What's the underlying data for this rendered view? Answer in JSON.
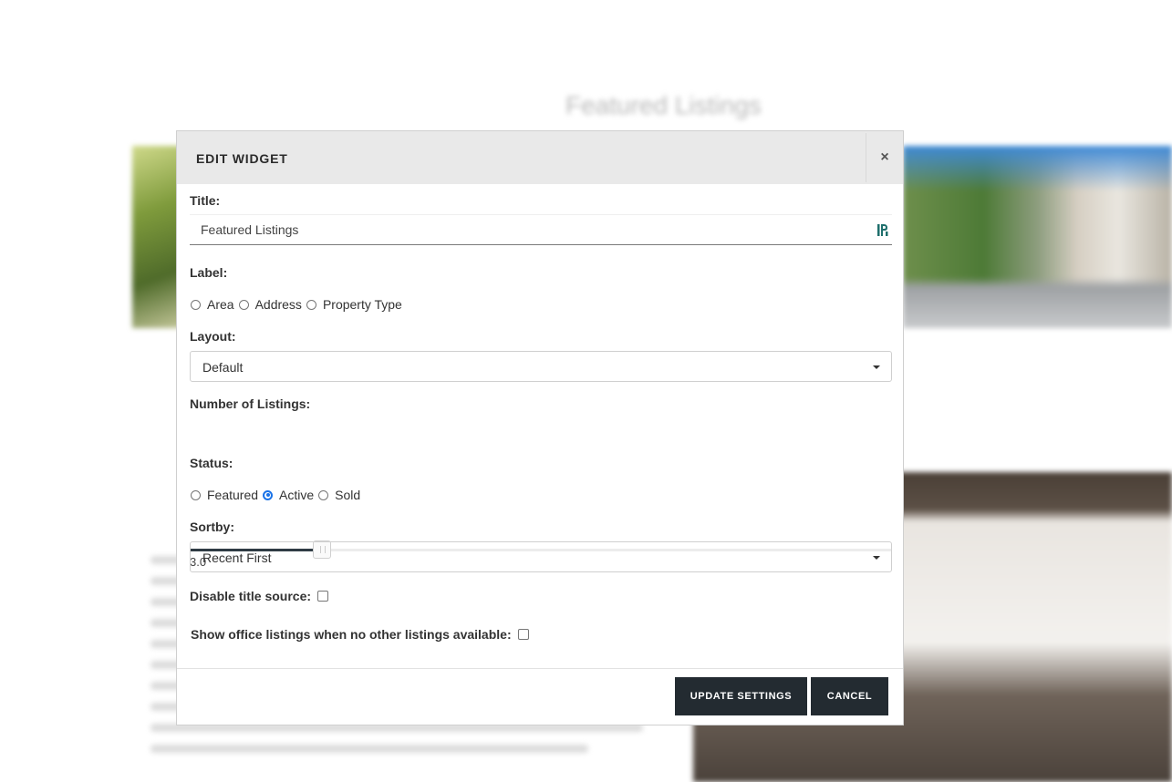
{
  "background": {
    "heading": "Featured Listings"
  },
  "modal": {
    "title": "EDIT WIDGET",
    "close_label": "×",
    "title_field": {
      "label": "Title:",
      "value": "Featured Listings"
    },
    "label_field": {
      "label": "Label:",
      "options": [
        "Area",
        "Address",
        "Property Type"
      ],
      "selected": null
    },
    "layout_field": {
      "label": "Layout:",
      "value": "Default"
    },
    "listings_field": {
      "label": "Number of Listings:",
      "value": "3.0",
      "fraction": 0.18
    },
    "status_field": {
      "label": "Status:",
      "options": [
        "Featured",
        "Active",
        "Sold"
      ],
      "selected": "Active"
    },
    "sortby_field": {
      "label": "Sortby:",
      "value": "Recent First"
    },
    "disable_title_source": {
      "label": "Disable title source:",
      "checked": false
    },
    "show_office_listings": {
      "label": "Show office listings when no other listings available:",
      "checked": false
    },
    "buttons": {
      "update": "UPDATE SETTINGS",
      "cancel": "CANCEL"
    }
  },
  "colors": {
    "button_bg": "#232b31",
    "header_bg": "#e9e9e9",
    "radio_selected": "#1a73e8",
    "source_icon": "#1f6f6c"
  },
  "icons": {
    "close": "close-icon",
    "title_source": "title-source-icon",
    "dropdown": "chevron-down-icon"
  }
}
